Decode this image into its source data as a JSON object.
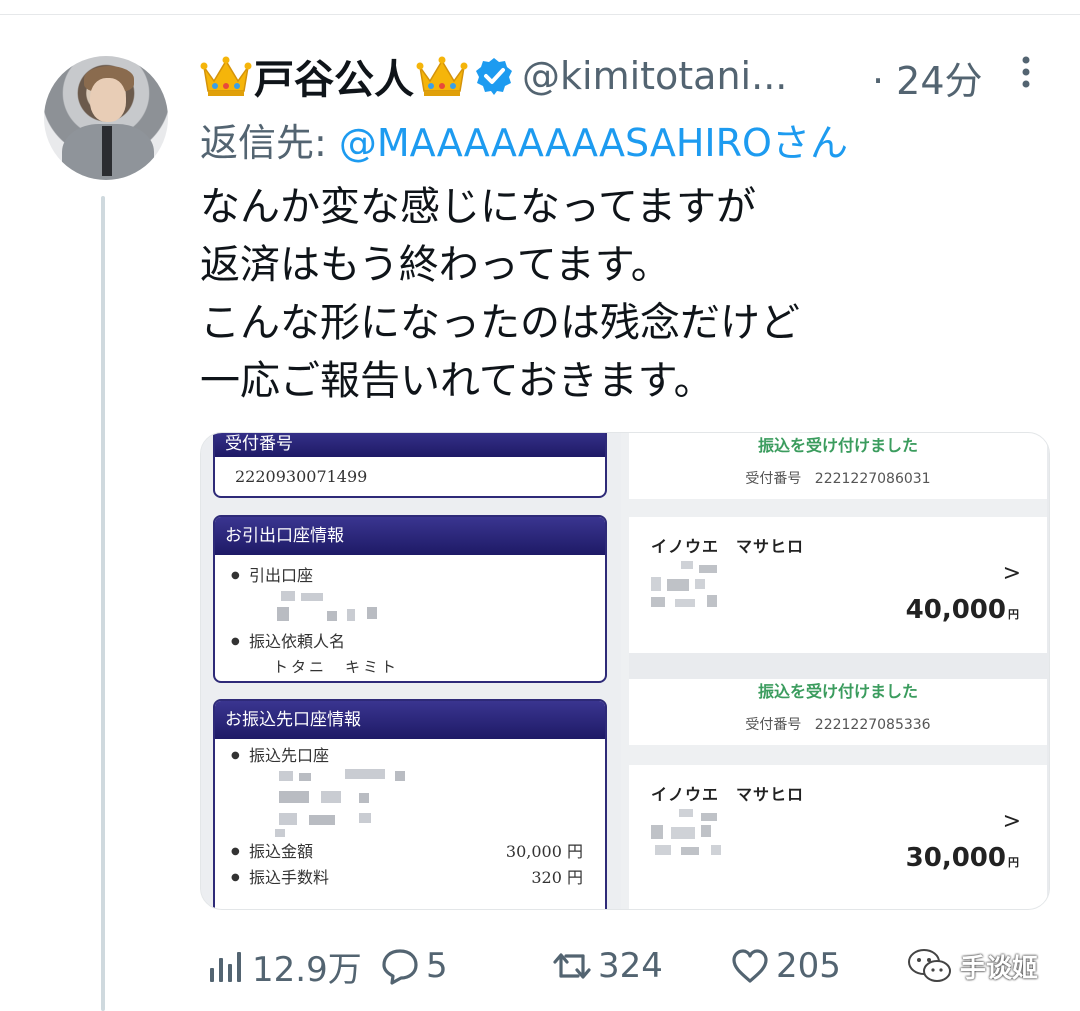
{
  "user": {
    "display_name": "戸谷公人",
    "handle": "@kimitotani...",
    "time": "· 24分",
    "reply_prefix": "返信先: ",
    "reply_mention": "@MAAAAAAAASAHIROさん"
  },
  "tweet": {
    "lines": [
      "なんか変な感じになってますが",
      "返済はもう終わってます。",
      "こんな形になったのは残念だけど",
      "一応ご報告いれておきます。"
    ]
  },
  "bank_slip": {
    "receipt_head": "受付番号",
    "receipt_number": "2220930071499",
    "withdraw_head": "お引出口座情報",
    "withdraw_account_label": "引出口座",
    "requester_label": "振込依頼人名",
    "requester_name": "トタニ　キミト",
    "dest_head": "お振込先口座情報",
    "dest_account_label": "振込先口座",
    "amount_label": "振込金額",
    "amount_value": "30,000 円",
    "fee_label": "振込手数料",
    "fee_value": "320 円"
  },
  "transfers": [
    {
      "title": "振込を受け付けました",
      "receipt_label": "受付番号",
      "receipt_number": "2221227086031",
      "name": "イノウエ　マサヒロ",
      "amount": "40,000",
      "unit": "円"
    },
    {
      "title": "振込を受け付けました",
      "receipt_label": "受付番号",
      "receipt_number": "2221227085336",
      "name": "イノウエ　マサヒロ",
      "amount": "30,000",
      "unit": "円"
    }
  ],
  "actions": {
    "views": "12.9万",
    "replies": "5",
    "retweets": "324",
    "likes": "205"
  },
  "watermark": {
    "text": "手谈姬"
  },
  "colors": {
    "link": "#1d9bf0",
    "muted": "#536471",
    "verified": "#1d9bf0",
    "bank_header": "#1e1a66",
    "transfer_title": "#3b9c5e"
  }
}
